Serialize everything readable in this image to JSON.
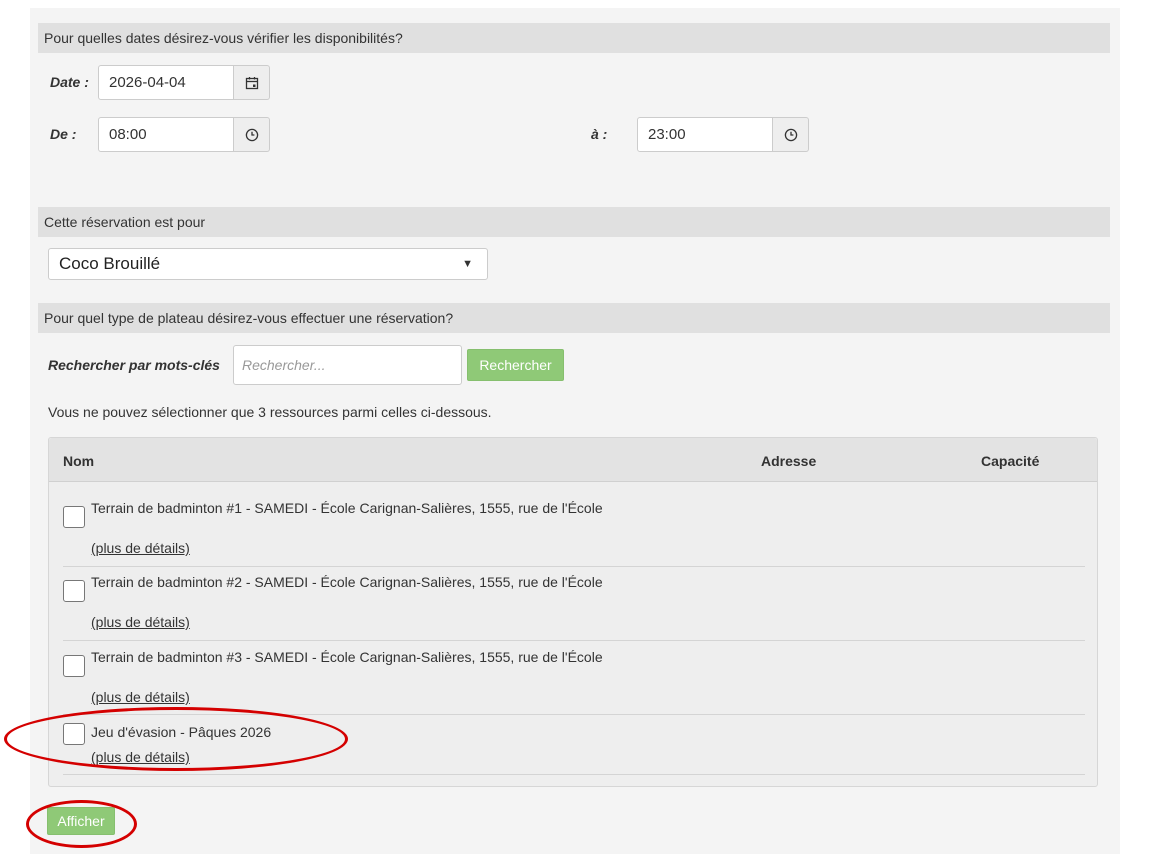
{
  "dates_section": {
    "header": "Pour quelles dates désirez-vous vérifier les disponibilités?",
    "date_label": "Date :",
    "date_value": "2026-04-04",
    "from_label": "De :",
    "from_value": "08:00",
    "to_label": "à :",
    "to_value": "23:00",
    "icons": {
      "date": "calendar-icon",
      "time": "clock-icon"
    }
  },
  "reservation_section": {
    "header": "Cette réservation est pour",
    "selected_person": "Coco Brouillé"
  },
  "plateau_section": {
    "header": "Pour quel type de plateau désirez-vous effectuer une réservation?",
    "search_label": "Rechercher par mots-clés",
    "search_placeholder": "Rechercher...",
    "search_button": "Rechercher",
    "info_text": "Vous ne pouvez sélectionner que 3 ressources parmi celles ci-dessous."
  },
  "table": {
    "columns": [
      "Nom",
      "Adresse",
      "Capacité"
    ],
    "rows": [
      {
        "name": "Terrain de badminton #1 - SAMEDI - École Carignan-Salières, 1555, rue de l'École",
        "link": "(plus de détails)"
      },
      {
        "name": "Terrain de badminton #2 - SAMEDI - École Carignan-Salières, 1555, rue de l'École",
        "link": "(plus de détails)"
      },
      {
        "name": "Terrain de badminton #3 - SAMEDI - École Carignan-Salières, 1555, rue de l'École",
        "link": "(plus de détails)"
      },
      {
        "name": "Jeu d'évasion - Pâques 2026",
        "link": "(plus de détails)"
      }
    ]
  },
  "footer": {
    "show_button": "Afficher"
  },
  "colors": {
    "accent_green": "#8fc977",
    "annotation_red": "#d40000",
    "section_header": "#e0e0e0",
    "panel": "#f4f4f4"
  }
}
